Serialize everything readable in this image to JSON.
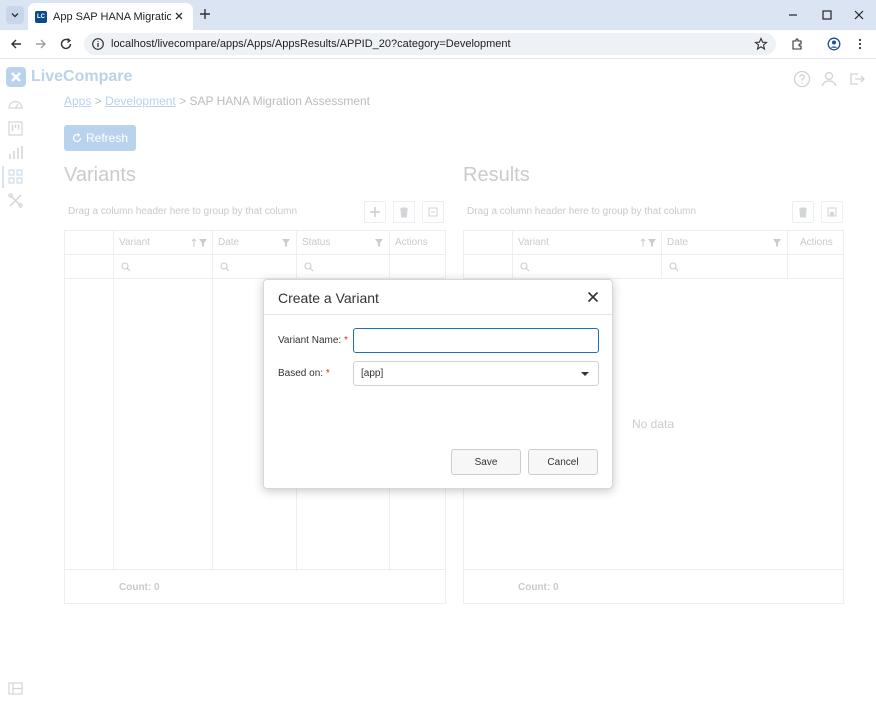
{
  "browser": {
    "tab_favicon": "LC",
    "tab_title": "App SAP HANA Migration Assessment",
    "url": "localhost/livecompare/apps/Apps/AppsResults/APPID_20?category=Development"
  },
  "app": {
    "brand": "LiveCompare",
    "breadcrumb": {
      "item1": "Apps",
      "sep": ">",
      "item2": "Development",
      "current": "SAP HANA Migration Assessment"
    },
    "refresh_label": "Refresh",
    "variants": {
      "title": "Variants",
      "group_hint": "Drag a column header here to group by that column",
      "columns": [
        "Variant",
        "Date",
        "Status",
        "Actions"
      ],
      "count": "Count: 0"
    },
    "results": {
      "title": "Results",
      "group_hint": "Drag a column header here to group by that column",
      "columns": [
        "Variant",
        "Date",
        "Actions"
      ],
      "no_data": "No data",
      "count": "Count: 0"
    }
  },
  "modal": {
    "title": "Create a Variant",
    "variant_name_label": "Variant Name:",
    "variant_name_value": "",
    "based_on_label": "Based on:",
    "required_mark": "*",
    "based_on_value": "[app]",
    "save_label": "Save",
    "cancel_label": "Cancel"
  },
  "colors": {
    "accent": "#1f6fb3",
    "faded_accent": "#b9d3ec",
    "required": "#d93025"
  }
}
